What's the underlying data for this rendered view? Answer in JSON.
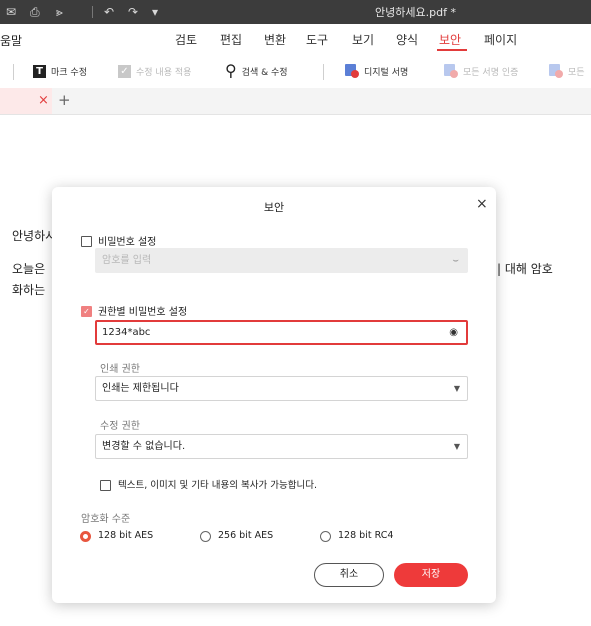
{
  "titlebar": {
    "title": "안녕하세요.pdf *",
    "icons": [
      "mail-icon",
      "print-icon",
      "share-icon",
      "undo-icon",
      "redo-icon",
      "dropdown-icon"
    ]
  },
  "menubar": {
    "left_label": "움말",
    "items": [
      {
        "label": "검토"
      },
      {
        "label": "편집"
      },
      {
        "label": "변환"
      },
      {
        "label": "도구"
      },
      {
        "label": "보기"
      },
      {
        "label": "양식"
      },
      {
        "label": "보안"
      },
      {
        "label": "페이지"
      }
    ],
    "active": "보안",
    "accent_color": "#e23b3b"
  },
  "toolbar": {
    "mark_edit": "마크 수정",
    "apply_edit": "수정 내용 적용",
    "search_edit": "검색 & 수정",
    "digital_sign": "디지털 서명",
    "verify_all": "모든 서명 인증",
    "clear_all": "모든"
  },
  "tabs": {
    "close_glyph": "×",
    "add_glyph": "+"
  },
  "document": {
    "line1": "안녕하시",
    "line2_left": "오늘은",
    "line2_right": "| 대해 암호",
    "line3": "화하는"
  },
  "dialog": {
    "title": "보안",
    "close_glyph": "×",
    "open_password": {
      "label": "비밀번호 설정",
      "checked": false,
      "placeholder": "암호를 입력"
    },
    "permission_password": {
      "label": "권한별 비밀번호 설정",
      "checked": true,
      "value": "1234*abc"
    },
    "print_permission": {
      "label": "인쇄 권한",
      "value": "인쇄는 제한됩니다"
    },
    "edit_permission": {
      "label": "수정 권한",
      "value": "변경할 수 없습니다."
    },
    "copy_option": {
      "label": "텍스트, 이미지 및 기타 내용의 복사가 가능합니다.",
      "checked": false
    },
    "encryption": {
      "label": "암호화 수준",
      "options": [
        "128 bit AES",
        "256 bit AES",
        "128 bit RC4"
      ],
      "selected": "128 bit AES"
    },
    "cancel_label": "취소",
    "save_label": "저장"
  }
}
